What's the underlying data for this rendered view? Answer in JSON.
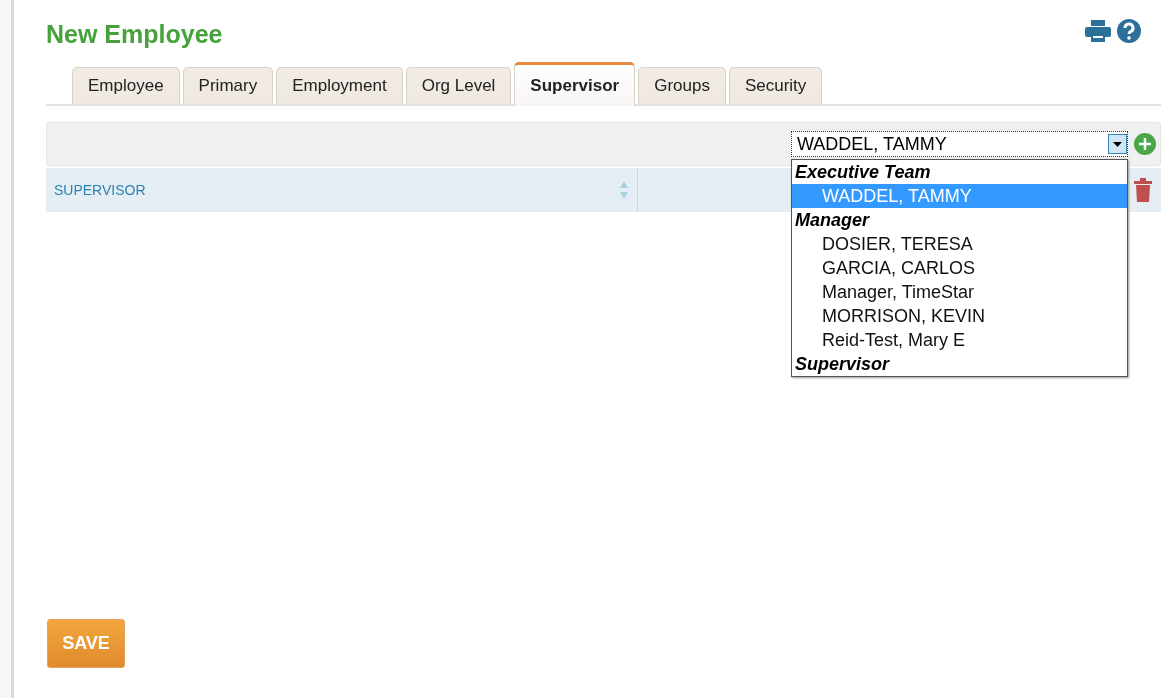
{
  "page": {
    "title": "New Employee"
  },
  "tabs": [
    {
      "label": "Employee",
      "selected": false
    },
    {
      "label": "Primary",
      "selected": false
    },
    {
      "label": "Employment",
      "selected": false
    },
    {
      "label": "Org Level",
      "selected": false
    },
    {
      "label": "Supervisor",
      "selected": true
    },
    {
      "label": "Groups",
      "selected": false
    },
    {
      "label": "Security",
      "selected": false
    }
  ],
  "supervisor_select": {
    "value": "WADDEL, TAMMY",
    "expanded": true,
    "options": [
      {
        "kind": "group",
        "label": "Executive Team"
      },
      {
        "kind": "option",
        "label": "WADDEL, TAMMY",
        "selected": true
      },
      {
        "kind": "group",
        "label": "Manager"
      },
      {
        "kind": "option",
        "label": "DOSIER, TERESA",
        "selected": false
      },
      {
        "kind": "option",
        "label": "GARCIA, CARLOS",
        "selected": false
      },
      {
        "kind": "option",
        "label": "Manager, TimeStar",
        "selected": false
      },
      {
        "kind": "option",
        "label": "MORRISON, KEVIN",
        "selected": false
      },
      {
        "kind": "option",
        "label": "Reid-Test, Mary E",
        "selected": false
      },
      {
        "kind": "group",
        "label": "Supervisor"
      }
    ]
  },
  "table": {
    "columns": [
      "SUPERVISOR"
    ]
  },
  "buttons": {
    "save": "SAVE"
  }
}
